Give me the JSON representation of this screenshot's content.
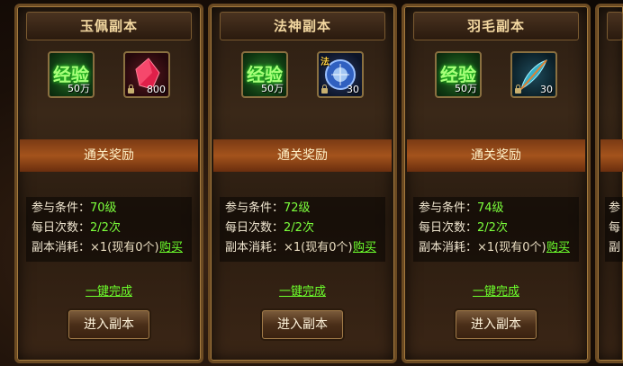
{
  "cards": [
    {
      "title": "玉佩副本",
      "reward_exp_label": "经验",
      "reward_exp_qty": "50万",
      "reward_item_icon": "red-gem-icon",
      "reward_item_qty": "800",
      "reward_bar": "通关奖励",
      "req_label": "参与条件：",
      "req_value": "70级",
      "daily_label": "每日次数：",
      "daily_value": "2/2次",
      "cost_label": "副本消耗：",
      "cost_value": "×1(现有0个)",
      "buy": "购买",
      "onekey": "一键完成",
      "enter": "进入副本"
    },
    {
      "title": "法神副本",
      "reward_exp_label": "经验",
      "reward_exp_qty": "50万",
      "reward_item_icon": "blue-orb-icon",
      "reward_item_tag": "法",
      "reward_item_qty": "30",
      "reward_bar": "通关奖励",
      "req_label": "参与条件：",
      "req_value": "72级",
      "daily_label": "每日次数：",
      "daily_value": "2/2次",
      "cost_label": "副本消耗：",
      "cost_value": "×1(现有0个)",
      "buy": "购买",
      "onekey": "一键完成",
      "enter": "进入副本"
    },
    {
      "title": "羽毛副本",
      "reward_exp_label": "经验",
      "reward_exp_qty": "50万",
      "reward_item_icon": "feather-icon",
      "reward_item_qty": "30",
      "reward_bar": "通关奖励",
      "req_label": "参与条件：",
      "req_value": "74级",
      "daily_label": "每日次数：",
      "daily_value": "2/2次",
      "cost_label": "副本消耗：",
      "cost_value": "×1(现有0个)",
      "buy": "购买",
      "onekey": "一键完成",
      "enter": "进入副本"
    }
  ],
  "partial_card": {
    "row_prefix_1": "参",
    "row_prefix_2": "每",
    "row_prefix_3": "副"
  },
  "colors": {
    "green_text": "#7cff3c",
    "title_text": "#f2d7a0",
    "frame_gold": "#a47a3e"
  }
}
